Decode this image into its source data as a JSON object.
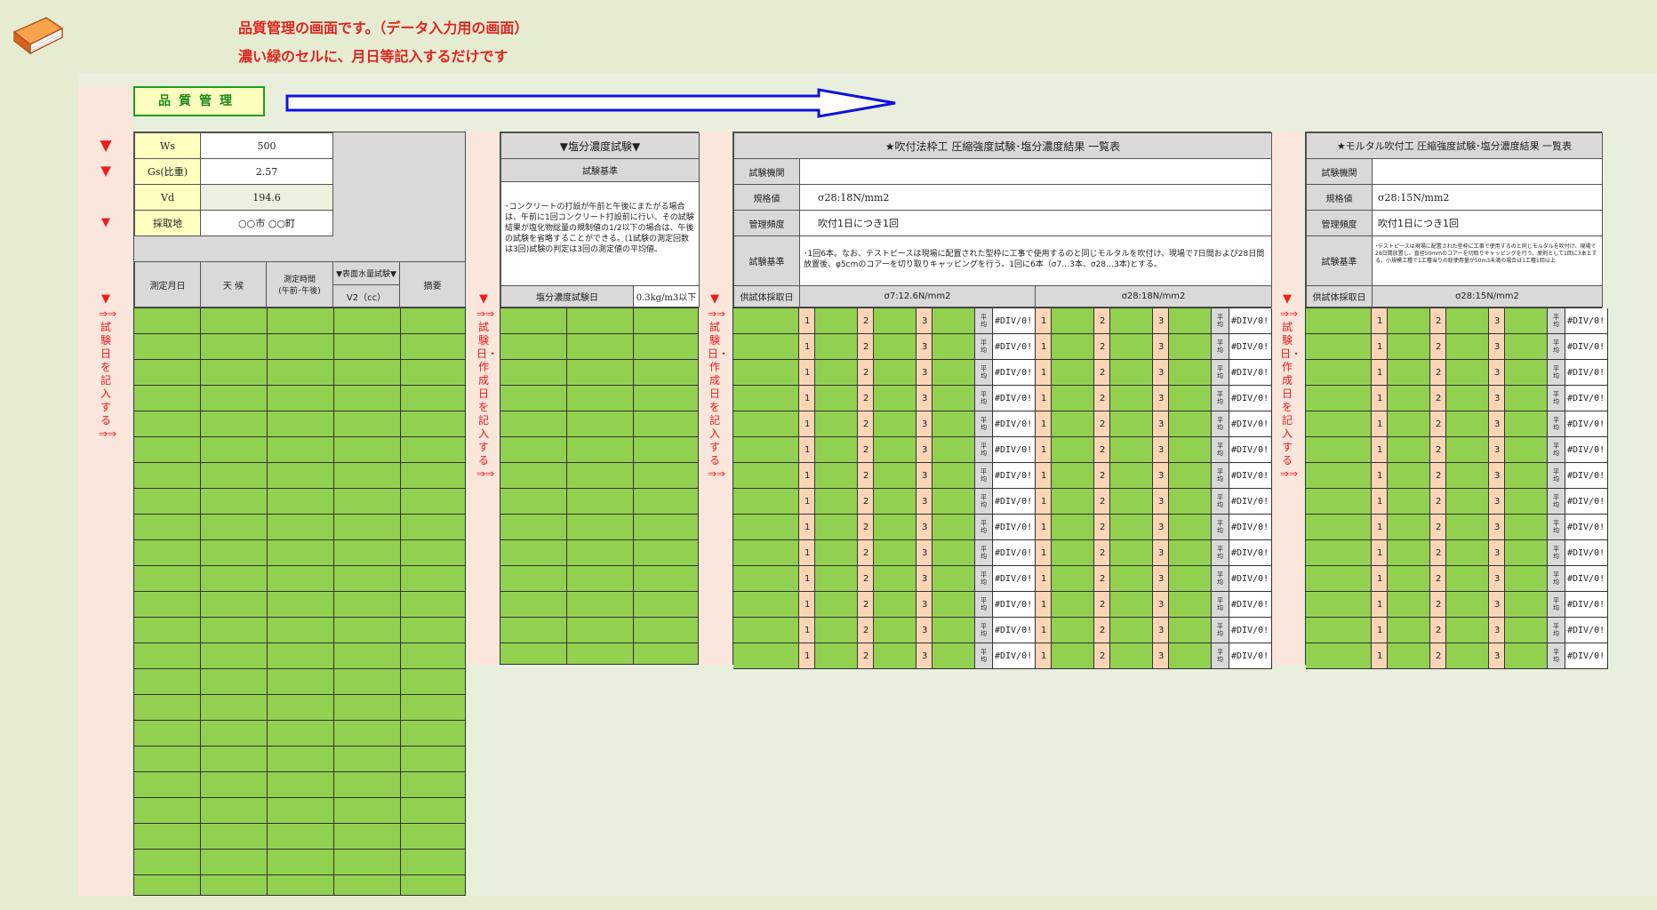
{
  "header": {
    "line1": "品質管理の画面です。（データ入力用の画面）",
    "line2": "濃い緑のセルに、月日等記入するだけです"
  },
  "title_box": "品質管理",
  "instructions": {
    "strip1": "⇒⇒試験日を記入する⇒⇒",
    "strip2": "⇒⇒試験日・作成日を記入する⇒⇒",
    "strip3": "⇒⇒試験日・作成日を記入する⇒⇒",
    "strip4": "⇒⇒試験日・作成日を記入する⇒⇒"
  },
  "params": {
    "ws_label": "Ws",
    "ws_value": "500",
    "gs_label": "Gs(比重)",
    "gs_value": "2.57",
    "vd_label": "Vd",
    "vd_value": "194.6",
    "site_label": "採取地",
    "site_value": "○○市 ○○町"
  },
  "table1_headers": {
    "date": "測定月日",
    "weather": "天 候",
    "time": "測定時間\n(午前･午後)",
    "water": "▼表面水量試験▼",
    "v2": "V2（cc）",
    "note": "摘要"
  },
  "table2": {
    "title": "▼塩分濃度試験▼",
    "criteria_label": "試験基準",
    "criteria_text": "･コンクリートの打設が午前と午後にまたがる場合は、午前に1回コンクリート打設前に行い、その試験結果が塩化物総量の規制値の1/2以下の場合は、午後の試験を省略することができる。(1試験の測定回数は3回)試験の判定は3回の測定値の平均値。",
    "date_label": "塩分濃度試験日",
    "limit": "0.3kg/m3以下"
  },
  "table3": {
    "title": "★吹付法枠工 圧縮強度試験･塩分濃度結果 一覧表",
    "agency_label": "試験機関",
    "agency_value": "",
    "spec_label": "規格値",
    "spec_value": "σ28:18N/mm2",
    "freq_label": "管理頻度",
    "freq_value": "吹付1日につき1回",
    "criteria_label": "試験基準",
    "criteria_text": "･1回6本。なお、テストピースは現場に配置された型枠に工事で使用するのと同じモルタルを吹付け、現場で7日間および28日間放置後、φ5cmのコアーを切り取りキャッピングを行う。1回に6本（σ7…3本、σ28…3本)とする。",
    "date_label": "供試体採取日",
    "col1": "σ7:12.6N/mm2",
    "col2": "σ28:18N/mm2"
  },
  "table4": {
    "title": "★モルタル吹付工 圧縮強度試験･塩分濃度結果 一覧表",
    "agency_label": "試験機関",
    "agency_value": "",
    "spec_label": "規格値",
    "spec_value": "σ28:15N/mm2",
    "freq_label": "管理頻度",
    "freq_value": "吹付1日につき1回",
    "criteria_label": "試験基準",
    "criteria_text": "･テストピースは現場に配置された型枠に工事で使用するのと同じモルタルを吹付け、現場で28日間放置し、直径50mmのコアーを切取りキャッピングを行う。原則として1回に3本とする。小規模工種で1工種当りの総使用量が50m3未満の場合は1工種1回以上",
    "date_label": "供試体採取日",
    "col1": "σ28:15N/mm2"
  },
  "row_cells": {
    "n1": "1",
    "n2": "2",
    "n3": "3",
    "avg": "平均",
    "error": "#DIV/0!"
  },
  "colors": {
    "green": "#92d050",
    "peach": "#fbd5b5",
    "header_gray": "#d9d9d9",
    "instruction_red": "#ee1c1c"
  }
}
